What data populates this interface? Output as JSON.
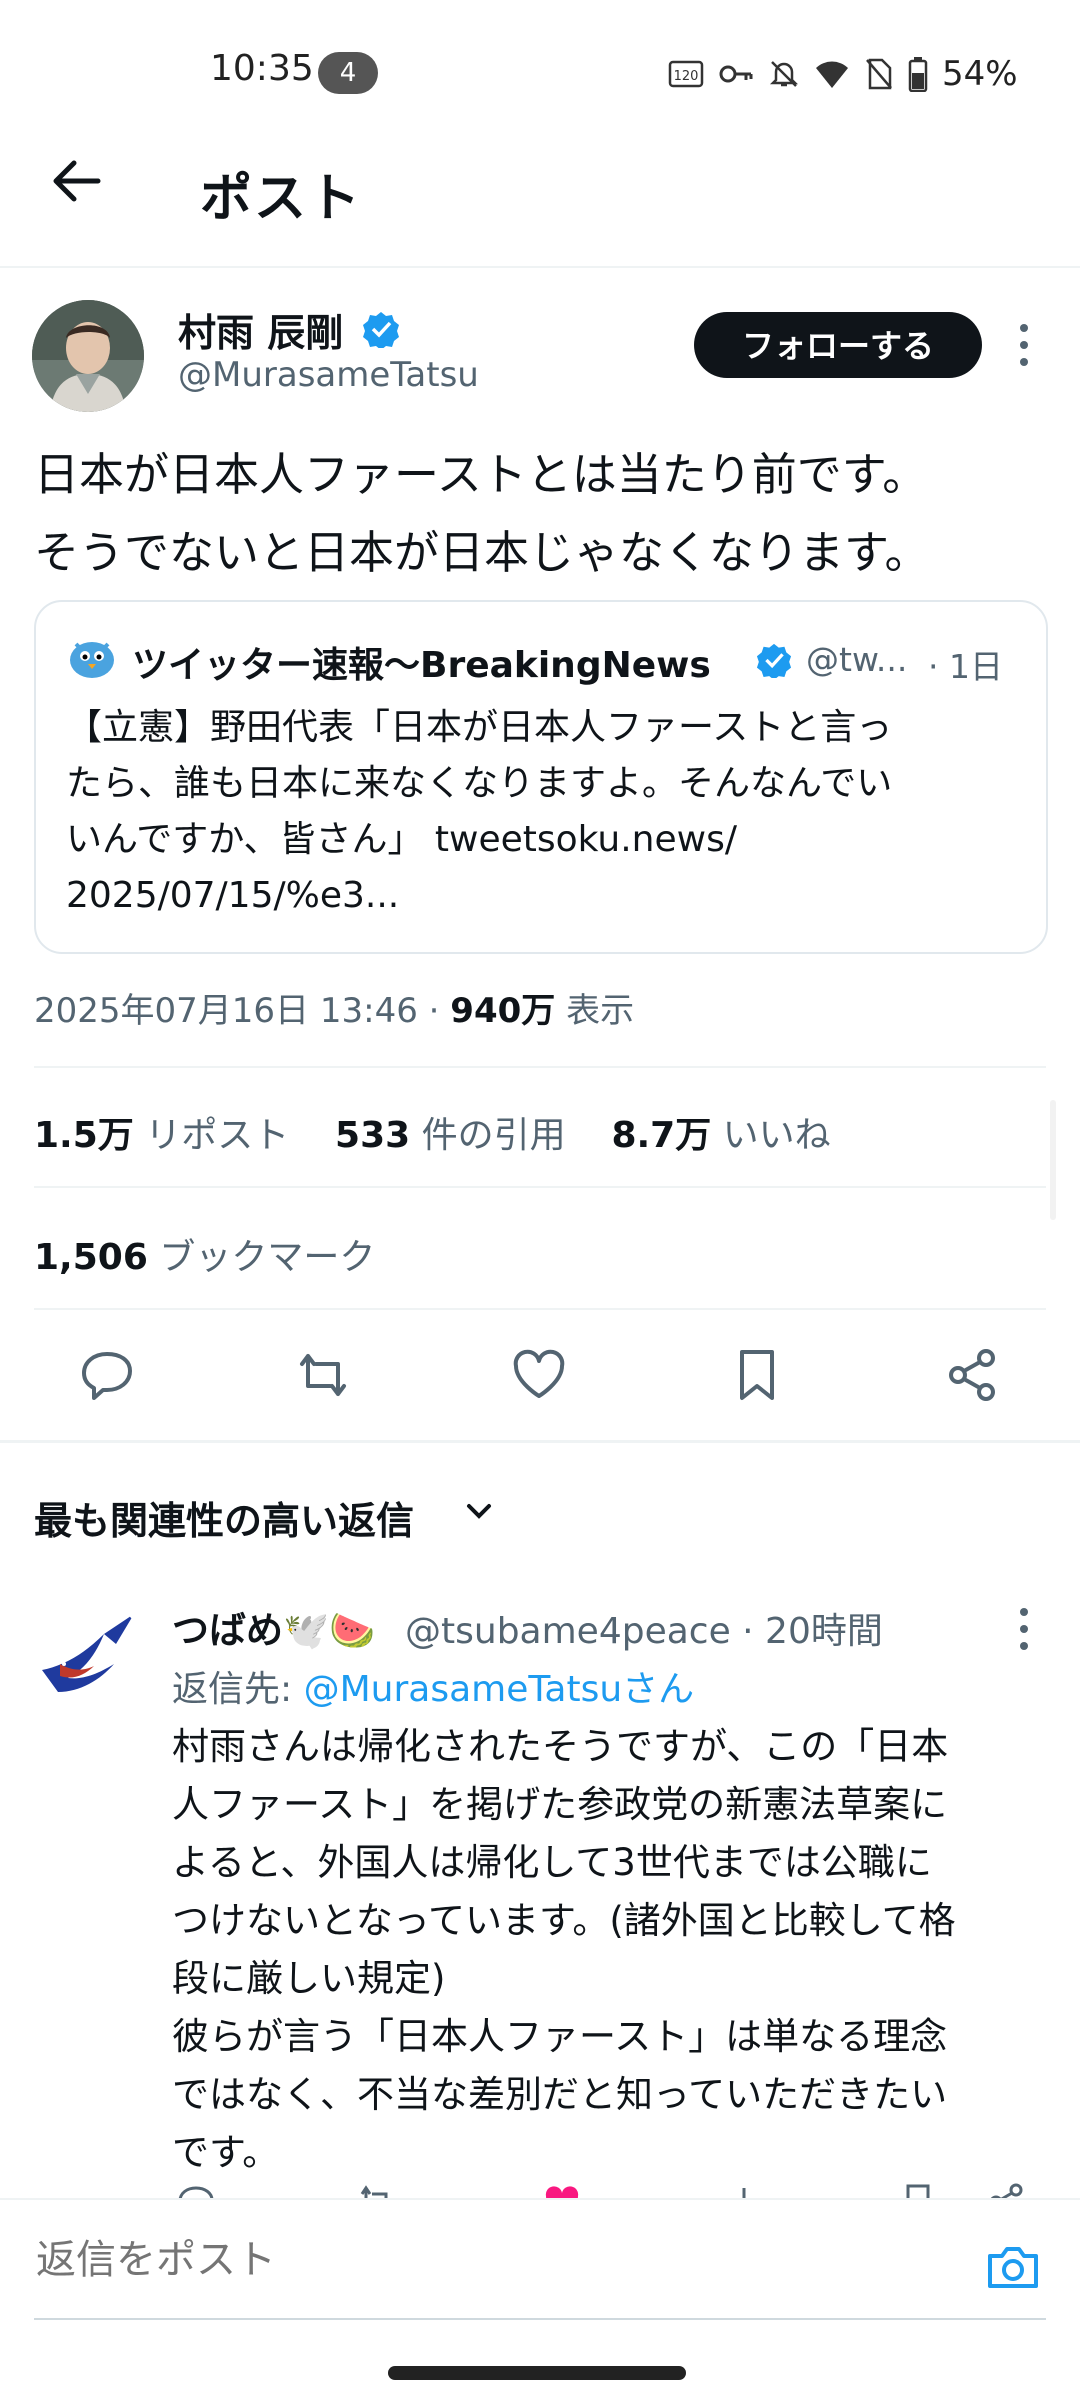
{
  "status_bar": {
    "time": "10:35",
    "notification_count": "4",
    "battery": "54%",
    "icons": [
      "120hz-icon",
      "key-icon",
      "bell-off-icon",
      "wifi-icon",
      "no-sim-icon",
      "battery-icon"
    ]
  },
  "header": {
    "title": "ポスト"
  },
  "post": {
    "author_name": "村雨 辰剛",
    "author_handle": "@MurasameTatsu",
    "follow_label": "フォローする",
    "text_line1": "日本が日本人ファーストとは当たり前です。",
    "text_line2": "そうでないと日本が日本じゃなくなります。",
    "quote": {
      "name": "ツイッター速報〜BreakingNews",
      "handle": "@tw...",
      "time": "· 1日",
      "text_line1": "【立憲】野田代表「日本が日本人ファーストと言っ",
      "text_line2": "たら、誰も日本に来なくなりますよ。そんなんでい",
      "text_line3": "いんですか、皆さん」 tweetsoku.news/",
      "text_line4": "2025/07/15/%e3..."
    },
    "datetime": "2025年07月16日 13:46",
    "views_value": "940万",
    "views_label": "表示",
    "reposts_value": "1.5万",
    "reposts_label": "リポスト",
    "quotes_value": "533",
    "quotes_label": "件の引用",
    "likes_value": "8.7万",
    "likes_label": "いいね",
    "bookmarks_value": "1,506",
    "bookmarks_label": "ブックマーク"
  },
  "replies": {
    "sort_label": "最も関連性の高い返信",
    "items": [
      {
        "name": "つばめ🕊️🍉",
        "handle": "@tsubame4peace · 20時間",
        "reply_to_prefix": "返信先:",
        "reply_to_mention": "@MurasameTatsuさん",
        "lines": [
          "村雨さんは帰化されたそうですが、この「日本",
          "人ファースト」を掲げた参政党の新憲法草案に",
          "よると、外国人は帰化して3世代までは公職に",
          "つけないとなっています。(諸外国と比較して格",
          "段に厳しい規定)",
          "彼らが言う「日本人ファースト」は単なる理念",
          "ではなく、不当な差別だと知っていただきたい",
          "です。"
        ]
      }
    ]
  },
  "compose": {
    "placeholder": "返信をポスト"
  },
  "colors": {
    "accent": "#1d9bf0",
    "text": "#0f1419",
    "muted": "#536471",
    "like": "#f91880"
  }
}
